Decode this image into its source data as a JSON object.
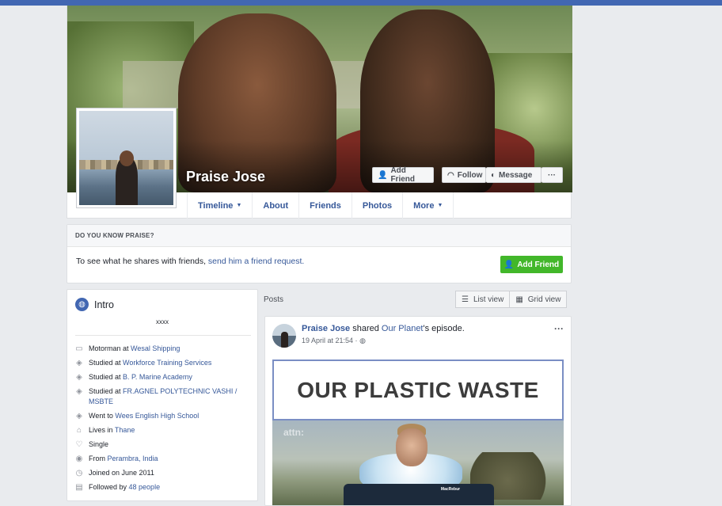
{
  "profile": {
    "name": "Praise Jose",
    "buttons": {
      "add_friend": "Add Friend",
      "follow": "Follow",
      "message": "Message",
      "more": "···"
    },
    "tabs": [
      {
        "label": "Timeline",
        "caret": "▼"
      },
      {
        "label": "About"
      },
      {
        "label": "Friends"
      },
      {
        "label": "Photos"
      },
      {
        "label": "More",
        "caret": "▼"
      }
    ]
  },
  "know_box": {
    "header": "DO YOU KNOW PRAISE?",
    "text": "To see what he shares with friends, ",
    "link": "send him a friend request.",
    "button": "Add Friend"
  },
  "intro": {
    "title": "Intro",
    "bio": "xxxx",
    "items": [
      {
        "icon": "briefcase-icon",
        "glyph": "▭",
        "prefix": "Motorman at ",
        "link": "Wesal Shipping",
        "suffix": ""
      },
      {
        "icon": "graduation-cap-icon",
        "glyph": "◈",
        "prefix": "Studied at ",
        "link": "Workforce Training Services",
        "suffix": ""
      },
      {
        "icon": "graduation-cap-icon",
        "glyph": "◈",
        "prefix": "Studied at ",
        "link": "B. P. Marine Academy",
        "suffix": ""
      },
      {
        "icon": "graduation-cap-icon",
        "glyph": "◈",
        "prefix": "Studied at ",
        "link": "FR.AGNEL POLYTECHNIC VASHI / MSBTE",
        "suffix": ""
      },
      {
        "icon": "graduation-cap-icon",
        "glyph": "◈",
        "prefix": "Went to ",
        "link": "Wees English High School",
        "suffix": ""
      },
      {
        "icon": "home-icon",
        "glyph": "⌂",
        "prefix": "Lives in ",
        "link": "Thane",
        "suffix": ""
      },
      {
        "icon": "heart-icon",
        "glyph": "♡",
        "prefix": "Single",
        "link": "",
        "suffix": ""
      },
      {
        "icon": "location-pin-icon",
        "glyph": "◉",
        "prefix": "From ",
        "link": "Perambra, India",
        "suffix": ""
      },
      {
        "icon": "clock-icon",
        "glyph": "◷",
        "prefix": "Joined on June 2011",
        "link": "",
        "suffix": ""
      },
      {
        "icon": "followers-icon",
        "glyph": "▤",
        "prefix": "Followed by ",
        "link": "48 people",
        "suffix": ""
      }
    ]
  },
  "posts": {
    "label": "Posts",
    "view_toggle": {
      "list": "List view",
      "grid": "Grid view"
    },
    "post": {
      "author": "Praise Jose",
      "action": " shared ",
      "page": "Our Planet",
      "suffix": "'s episode.",
      "time": "19 April at 21:54 ·",
      "privacy_glyph": "◍",
      "banner_text": "OUR PLASTIC WASTE",
      "video_watermark": "attn:",
      "video_logo": "MacRebur"
    }
  },
  "colors": {
    "brand": "#4267b2",
    "link": "#365899",
    "green": "#42b72a",
    "page_bg": "#e9ebee"
  }
}
